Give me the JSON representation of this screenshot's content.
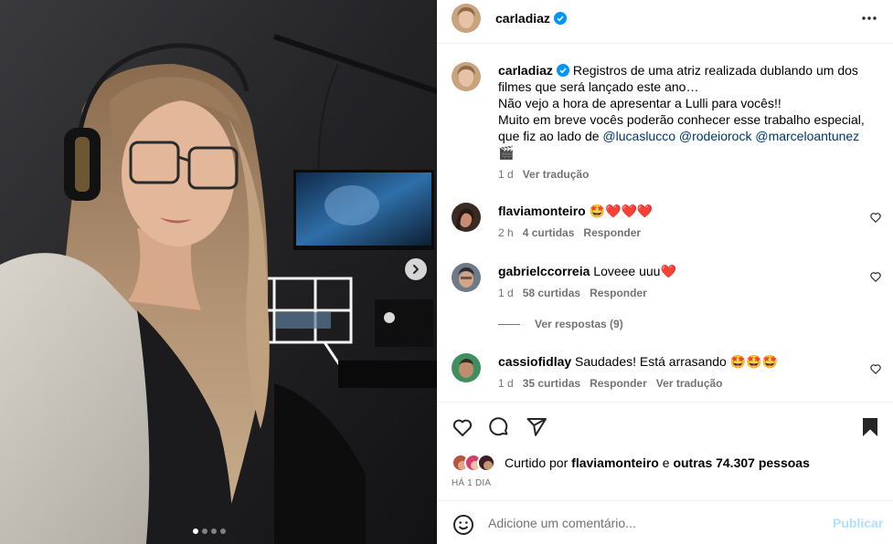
{
  "post": {
    "author": "carladiaz",
    "caption_lines": [
      "Registros de uma atriz realizada dublando um dos",
      "filmes que será lançado este ano…",
      "Não vejo a hora de apresentar a Lulli para vocês!!",
      "Muito em breve vocês poderão conhecer esse trabalho especial,",
      "que fiz ao lado de"
    ],
    "mentions": [
      "@lucaslucco",
      "@rodeiorock",
      "@marceloantunez"
    ],
    "caption_emoji": "🎬",
    "time": "1 d",
    "translate_label": "Ver tradução",
    "carousel_count": 4,
    "carousel_active": 0
  },
  "comments": [
    {
      "username": "flaviamonteiro",
      "text": "🤩❤️❤️❤️",
      "time": "2 h",
      "likes": "4 curtidas",
      "reply": "Responder"
    },
    {
      "username": "gabrielccorreia",
      "text": "Loveee uuu❤️",
      "time": "1 d",
      "likes": "58 curtidas",
      "reply": "Responder",
      "view_replies": "Ver respostas (9)"
    },
    {
      "username": "cassiofidlay",
      "text": "Saudades! Está arrasando 🤩🤩🤩",
      "time": "1 d",
      "likes": "35 curtidas",
      "reply": "Responder",
      "translate": "Ver tradução"
    }
  ],
  "likes": {
    "prefix": "Curtido por",
    "first_user": "flaviamonteiro",
    "connector": "e",
    "others": "outras 74.307 pessoas"
  },
  "posted_ago": "HÁ 1 DIA",
  "add_comment": {
    "placeholder": "Adicione um comentário...",
    "publish_label": "Publicar"
  },
  "colors": {
    "verified": "#0095f6",
    "publish_disabled": "#b2dffc",
    "mention": "#00376b",
    "secondary_text": "#737373"
  }
}
